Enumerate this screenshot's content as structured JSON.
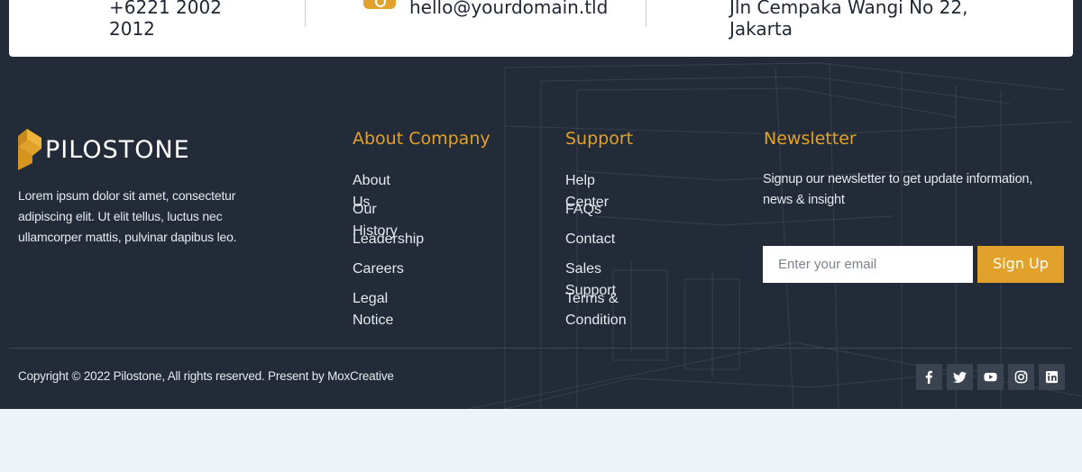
{
  "contact_bar": {
    "phone": "+6221 2002 2012",
    "email": "hello@yourdomain.tld",
    "address": "Jln Cempaka Wangi No 22, Jakarta"
  },
  "brand": {
    "name": "PILOSTONE",
    "description": "Lorem ipsum dolor sit amet, consectetur adipiscing elit. Ut elit tellus, luctus nec ullamcorper mattis, pulvinar dapibus leo."
  },
  "about_company": {
    "title": "About Company",
    "links": [
      "About Us",
      "Our History",
      "Leadership",
      "Careers",
      "Legal Notice"
    ]
  },
  "support": {
    "title": "Support",
    "links": [
      "Help Center",
      "FAQs",
      "Contact",
      "Sales Support",
      "Terms & Condition"
    ]
  },
  "newsletter": {
    "title": "Newsletter",
    "text": "Signup our newsletter to get update information, news & insight",
    "input_placeholder": "Enter your email",
    "button_label": "Sign Up"
  },
  "copyright": "Copyright © 2022 Pilostone, All rights reserved. Present by MoxCreative",
  "social_icons": [
    "facebook-icon",
    "twitter-icon",
    "youtube-icon",
    "instagram-icon",
    "linkedin-icon"
  ],
  "colors": {
    "accent": "#e2a12a",
    "footer_bg": "#222b37",
    "page_bg": "#eef3f7"
  }
}
